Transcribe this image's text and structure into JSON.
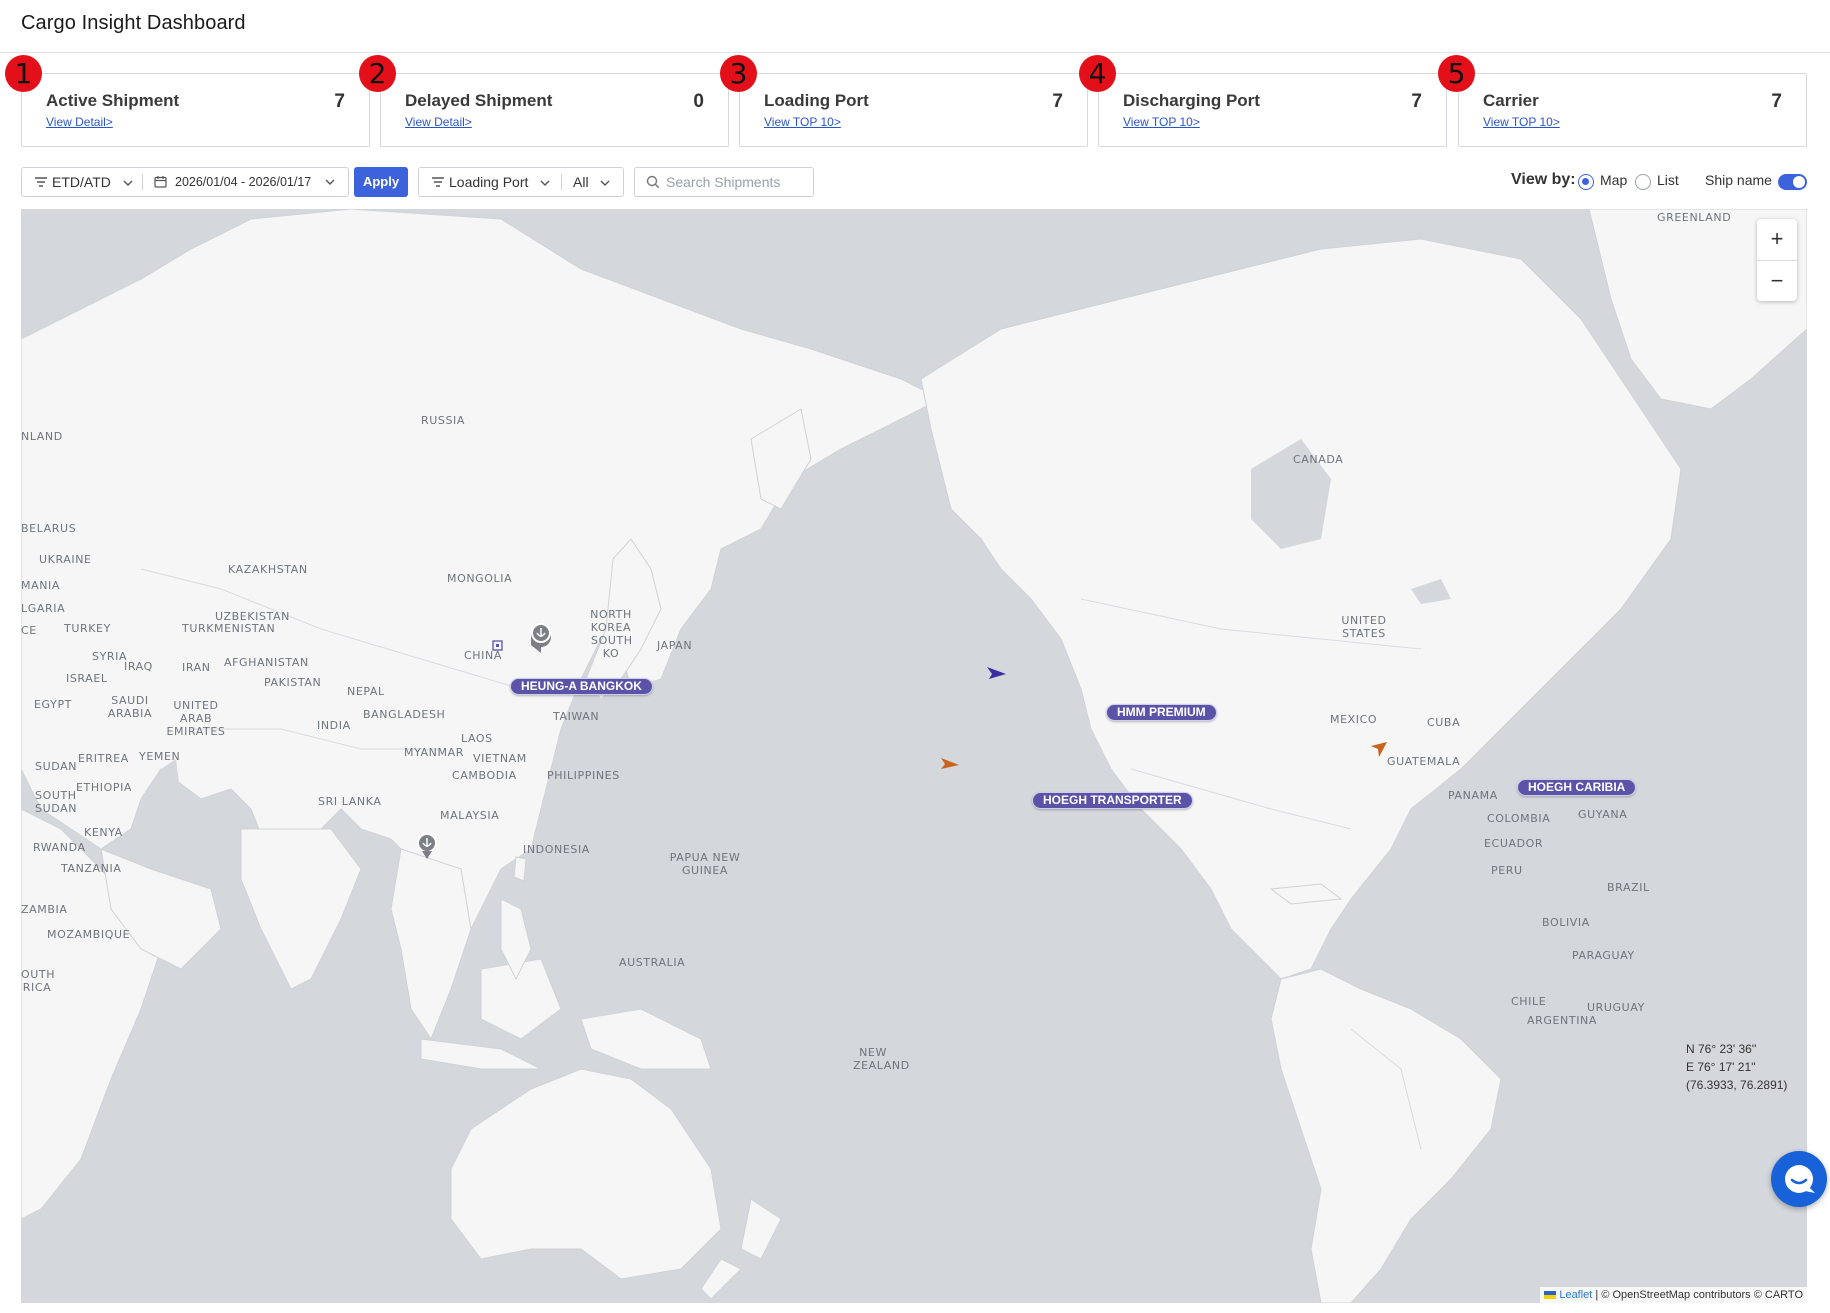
{
  "app": {
    "title": "Cargo Insight Dashboard"
  },
  "kpis": [
    {
      "badge": "1",
      "title": "Active Shipment",
      "value": "7",
      "link": "View Detail>"
    },
    {
      "badge": "2",
      "title": "Delayed Shipment",
      "value": "0",
      "link": "View Detail>"
    },
    {
      "badge": "3",
      "title": "Loading Port",
      "value": "7",
      "link": "View TOP 10>"
    },
    {
      "badge": "4",
      "title": "Discharging Port",
      "value": "7",
      "link": "View TOP 10>"
    },
    {
      "badge": "5",
      "title": "Carrier",
      "value": "7",
      "link": "View TOP 10>"
    }
  ],
  "filters": {
    "date_type": "ETD/ATD",
    "date_range": "2026/01/04 - 2026/01/17",
    "apply_label": "Apply",
    "port_type": "Loading Port",
    "port_value": "All",
    "search_placeholder": "Search Shipments"
  },
  "view": {
    "label": "View by:",
    "options": [
      "Map",
      "List"
    ],
    "selected": "Map",
    "ship_name_label": "Ship name",
    "ship_name_on": true
  },
  "map": {
    "places": {
      "greenland": "GREENLAND",
      "russia": "RUSSIA",
      "nland": "NLAND",
      "canada": "CANADA",
      "belarus": "BELARUS",
      "ukraine": "UKRAINE",
      "kazakhstan": "KAZAKHSTAN",
      "mongolia": "MONGOLIA",
      "mania": "MANIA",
      "lgaria": "LGARIA",
      "uzbekistan": "UZBEKISTAN",
      "turkmenistan": "TURKMENISTAN",
      "north_korea": "NORTH KOREA",
      "south_korea": "SOUTH KO",
      "japan": "JAPAN",
      "turkey": "TURKEY",
      "ce": "CE",
      "syria": "SYRIA",
      "iraq": "IRAQ",
      "iran": "IRAN",
      "afghanistan": "AFGHANISTAN",
      "china": "CHINA",
      "united_states": "UNITED STATES",
      "israel": "ISRAEL",
      "pakistan": "PAKISTAN",
      "nepal": "NEPAL",
      "egypt": "EGYPT",
      "saudi_arabia": "SAUDI ARABIA",
      "uae": "UNITED ARAB EMIRATES",
      "india": "INDIA",
      "bangladesh": "BANGLADESH",
      "taiwan": "TAIWAN",
      "mexico": "MEXICO",
      "cuba": "CUBA",
      "laos": "LAOS",
      "myanmar": "MYANMAR",
      "vietnam": "VIETNAM",
      "eritrea": "ERITREA",
      "yemen": "YEMEN",
      "sudan": "SUDAN",
      "cambodia": "CAMBODIA",
      "philippines": "PHILIPPINES",
      "guatemala": "GUATEMALA",
      "ethiopia": "ETHIOPIA",
      "south_sudan": "SOUTH SUDAN",
      "sri_lanka": "SRI LANKA",
      "panama": "PANAMA",
      "colombia": "COLOMBIA",
      "guyana": "GUYANA",
      "malaysia": "MALAYSIA",
      "kenya": "KENYA",
      "rwanda": "RWANDA",
      "indonesia": "INDONESIA",
      "ecuador": "ECUADOR",
      "tanzania": "TANZANIA",
      "png": "PAPUA NEW GUINEA",
      "peru": "PERU",
      "brazil": "BRAZIL",
      "zambia": "ZAMBIA",
      "bolivia": "BOLIVIA",
      "mozambique": "MOZAMBIQUE",
      "paraguay": "PARAGUAY",
      "australia": "AUSTRALIA",
      "outh_africa": "OUTH RICA",
      "chile": "CHILE",
      "uruguay": "URUGUAY",
      "argentina": "ARGENTINA",
      "new_zealand": "NEW ZEALAND"
    },
    "ships": [
      {
        "name": "HEUNG-A BANGKOK",
        "color": "#5a53a8"
      },
      {
        "name": "HMM PREMIUM",
        "color": "#3b2fa0"
      },
      {
        "name": "HOEGH TRANSPORTER",
        "color": "#c8641e"
      },
      {
        "name": "HOEGH CARIBIA",
        "color": "#c8641e"
      }
    ],
    "zoom_in": "+",
    "zoom_out": "−",
    "coords": {
      "lat": "N 76° 23' 36''",
      "lon": "E 76° 17' 21''",
      "decimal": "(76.3933, 76.2891)"
    },
    "attribution": {
      "leaflet": "Leaflet",
      "rest": "| © OpenStreetMap contributors © CARTO"
    }
  },
  "colors": {
    "accent": "#3d63dc",
    "badge": "#e3101a",
    "ship_label_bg": "#5a53a8",
    "land": "#f6f6f6",
    "water": "#d4d7dc"
  }
}
